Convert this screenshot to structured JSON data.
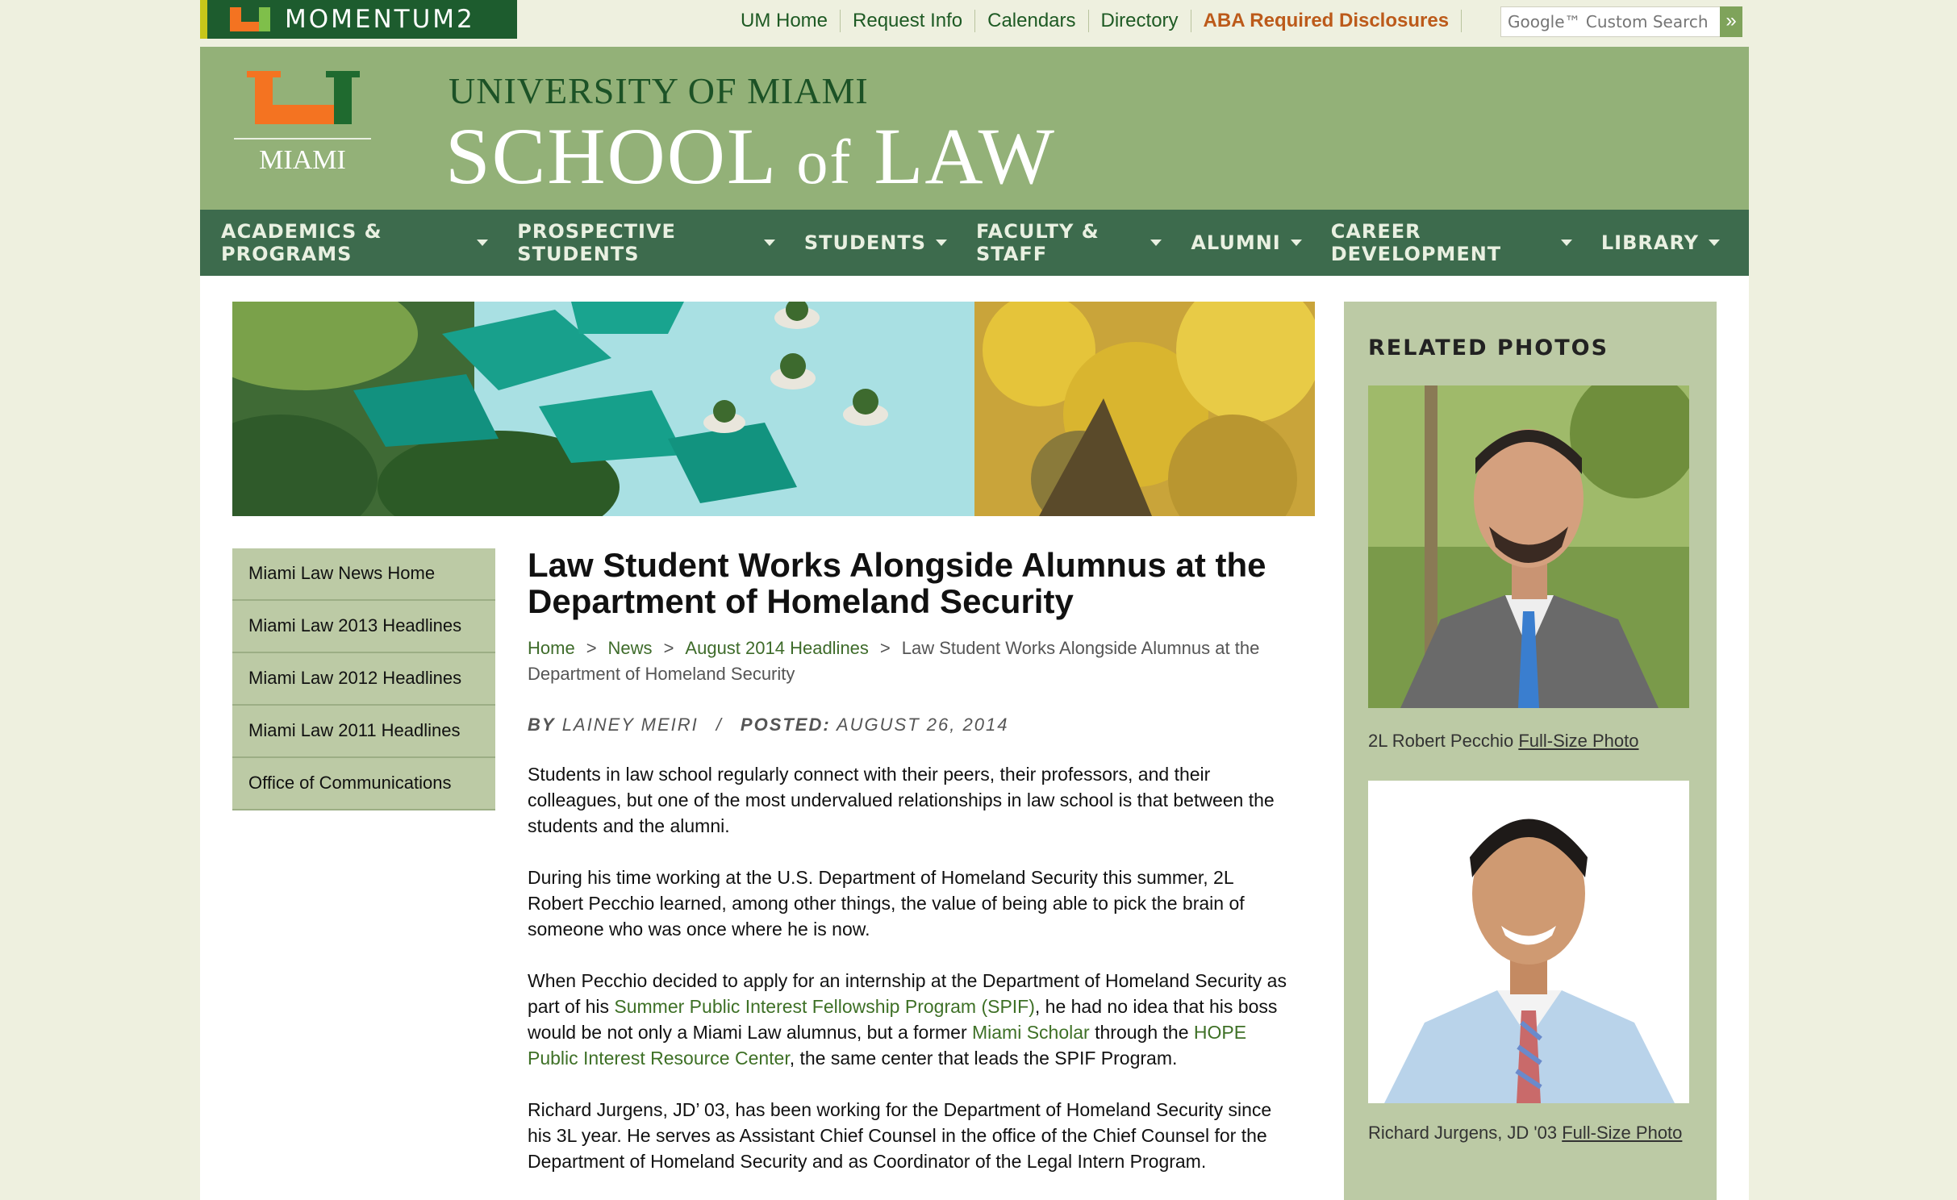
{
  "topbar": {
    "momentum_label": "MOMENTUM2",
    "links": [
      "UM Home",
      "Request Info",
      "Calendars",
      "Directory",
      "ABA Required Disclosures"
    ],
    "search_placeholder": "Google™ Custom Search",
    "search_button": "»"
  },
  "header": {
    "logo_text": "MIAMI",
    "university": "UNIVERSITY OF MIAMI",
    "school_a": "SCHOOL",
    "school_of": "of",
    "school_b": "LAW"
  },
  "nav": {
    "items": [
      "ACADEMICS & PROGRAMS",
      "PROSPECTIVE STUDENTS",
      "STUDENTS",
      "FACULTY & STAFF",
      "ALUMNI",
      "CAREER DEVELOPMENT",
      "LIBRARY"
    ]
  },
  "leftnav": {
    "items": [
      "Miami Law News Home",
      "Miami Law 2013 Headlines",
      "Miami Law 2012 Headlines",
      "Miami Law 2011 Headlines",
      "Office of Communications"
    ]
  },
  "article": {
    "title": "Law Student Works Alongside Alumnus at the Department of Homeland Security",
    "breadcrumb": {
      "home": "Home",
      "news": "News",
      "section": "August 2014 Headlines",
      "current": "Law Student Works Alongside Alumnus at the Department of Homeland Security",
      "separator": ">"
    },
    "byline": {
      "by_label": "BY",
      "author": "LAINEY MEIRI",
      "divider": "/",
      "posted_label": "POSTED:",
      "date": "AUGUST 26, 2014"
    },
    "p1": "Students in law school regularly connect with their peers, their professors, and their colleagues, but one of the most undervalued relationships in law school is that between the students and the alumni.",
    "p2": "During his time working at the U.S. Department of Homeland Security this summer, 2L Robert Pecchio learned, among other things, the value of being able to pick the brain of someone who was once where he is now.",
    "p3": {
      "t1": "When Pecchio decided to apply for an internship at the Department of Homeland Security as part of his ",
      "link1": "Summer Public Interest Fellowship Program (SPIF)",
      "t2": ", he had no idea that his boss would be not only a Miami Law alumnus, but a former ",
      "link2": "Miami Scholar",
      "t3": " through the ",
      "link3": "HOPE Public Interest Resource Center",
      "t4": ", the same center that leads the SPIF Program."
    },
    "p4": "Richard Jurgens, JD’ 03, has been working for the Department of Homeland Security since his 3L year. He serves as Assistant Chief Counsel in the office of the Chief Counsel for the Department of Homeland Security and as Coordinator of the Legal Intern Program."
  },
  "related": {
    "heading": "RELATED PHOTOS",
    "photos": [
      {
        "caption": "2L Robert Pecchio",
        "link": "Full-Size Photo"
      },
      {
        "caption": "Richard Jurgens, JD '03",
        "link": "Full-Size Photo"
      }
    ]
  },
  "colors": {
    "header_green": "#93b178",
    "nav_green": "#3d6b4d",
    "sidebar_green": "#bccaa5",
    "link_green": "#3e7026",
    "aba_orange": "#bc5a1a",
    "um_orange": "#f47321"
  }
}
